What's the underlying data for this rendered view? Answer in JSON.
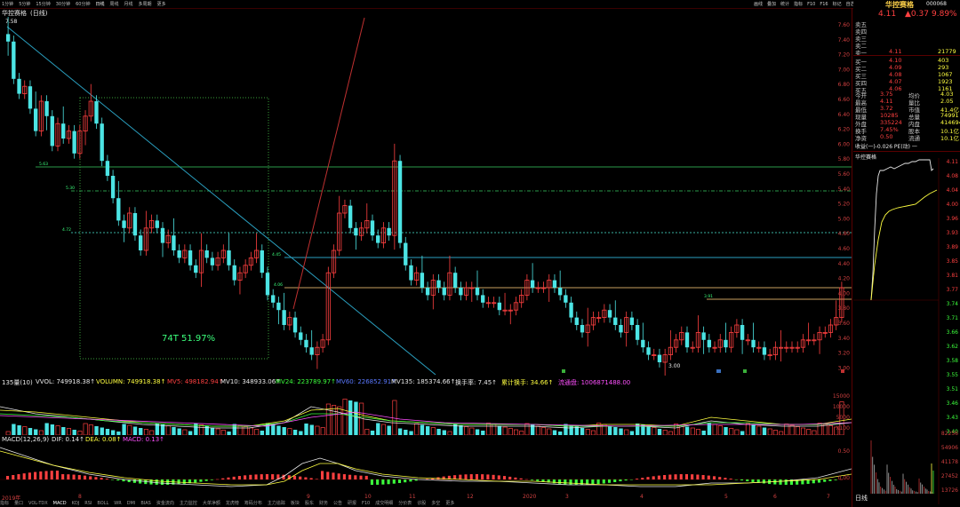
{
  "toolbar": {
    "left_tabs": [
      "1分钟",
      "5分钟",
      "15分钟",
      "30分钟",
      "60分钟",
      "日线",
      "周线",
      "月线",
      "多周期",
      "更多"
    ],
    "active_index": 5,
    "right_items": [
      "画线",
      "叠加",
      "统计",
      "指标",
      "F10",
      "F16",
      "标记",
      "自选",
      "返回"
    ]
  },
  "chart_header": {
    "stock_name": "华控赛格",
    "period": "(日线)",
    "high_marker": "7.58"
  },
  "price_axis_left": [
    "7.60",
    "7.40",
    "7.20",
    "7.00",
    "6.80",
    "6.60",
    "6.40",
    "6.20",
    "6.00",
    "5.80",
    "5.60",
    "5.40",
    "5.20",
    "5.00",
    "4.80",
    "4.60",
    "4.40",
    "4.20",
    "4.00",
    "3.80",
    "3.60",
    "3.40",
    "3.20",
    "3.00"
  ],
  "level_labels": [
    "5.63",
    "5.30",
    "4.72",
    "4.45",
    "4.06",
    "3.91",
    "3.00"
  ],
  "box_annotation": "74T 51.97%",
  "vol_header": {
    "title": "135量(10)",
    "vvol": "VVOL: 749918.38↑",
    "volumn": "VOLUMN: 749918.38↑",
    "mv5": "MV5: 498182.94↑",
    "mv10": "MV10: 348933.06↑",
    "mv24": "MV24: 223789.97↑",
    "mv60": "MV60: 226852.91↑",
    "mv135": "MV135: 185374.66↑",
    "turnover": "换手率: 7.45↑",
    "cum_turnover": "累计换手: 34.66↑",
    "flow": "流通盘: 1006871488.00"
  },
  "vol_axis": [
    "15000",
    "10000",
    "5000",
    "X100"
  ],
  "macd_header": {
    "title": "MACD(12,26,9)",
    "dif": "DIF: 0.14↑",
    "dea": "DEA: 0.08↑",
    "macd": "MACD: 0.13↑"
  },
  "macd_axis": [
    "0.50",
    "0.00"
  ],
  "x_axis": [
    "2019年",
    "8",
    "9",
    "10",
    "11",
    "12",
    "2020",
    "3",
    "4",
    "5",
    "6",
    "7"
  ],
  "bottom_tabs": [
    "指标",
    "量口",
    "VOL-TDX",
    "MACD",
    "KDJ",
    "RSI",
    "BOLL",
    "WR",
    "DMI",
    "BIAS",
    "资金流向",
    "主力监控",
    "大单净额",
    "龙虎榜",
    "筹码分布",
    "主力追踪",
    "板块",
    "股东",
    "财务",
    "公告",
    "研报",
    "F10",
    "成交明细",
    "分价表",
    "诊股",
    "多空",
    "更多"
  ],
  "bottom_active_index": 3,
  "quote": {
    "name": "华控赛格",
    "code": "000068",
    "price": "4.11",
    "change": "▲0.37",
    "pct": "9.89%",
    "sell_labels": [
      "卖五",
      "卖四",
      "卖三",
      "卖二",
      "卖一"
    ],
    "sell_prices": [
      "",
      "",
      "",
      "",
      "4.11"
    ],
    "sell_vols": [
      "",
      "",
      "",
      "",
      "21779"
    ],
    "buy_labels": [
      "买一",
      "买二",
      "买三",
      "买四",
      "买五"
    ],
    "buy_prices": [
      "4.10",
      "4.09",
      "4.08",
      "4.07",
      "4.06"
    ],
    "buy_vols": [
      "403",
      "293",
      "1067",
      "1923",
      "1161"
    ],
    "stats": [
      [
        "今开",
        "3.75",
        "均价",
        "4.03"
      ],
      [
        "最高",
        "4.11",
        "量比",
        "2.05"
      ],
      [
        "最低",
        "3.72",
        "市值",
        "41.4亿"
      ],
      [
        "现量",
        "10285",
        "总量",
        "74991"
      ],
      [
        "外盘",
        "335224",
        "内盘",
        "414694"
      ],
      [
        "换手",
        "7.45%",
        "股本",
        "10.1亿"
      ],
      [
        "净资",
        "0.50",
        "流通",
        "10.1亿"
      ]
    ],
    "earnings": "收益(一)-0.026 PE(动)   一",
    "mini_title": "华控赛格",
    "mini_right_axis": [
      "4.11",
      "4.08",
      "4.04",
      "4.00",
      "3.96",
      "3.93",
      "3.89",
      "3.85",
      "3.81",
      "3.77",
      "3.74",
      "3.71",
      "3.66",
      "3.62",
      "3.58",
      "3.55",
      "3.51",
      "3.46",
      "3.43",
      "3.40"
    ],
    "mini_vol_axis": [
      "82256",
      "54906",
      "41178",
      "27452",
      "13726"
    ],
    "mini_tab": "日线"
  }
}
